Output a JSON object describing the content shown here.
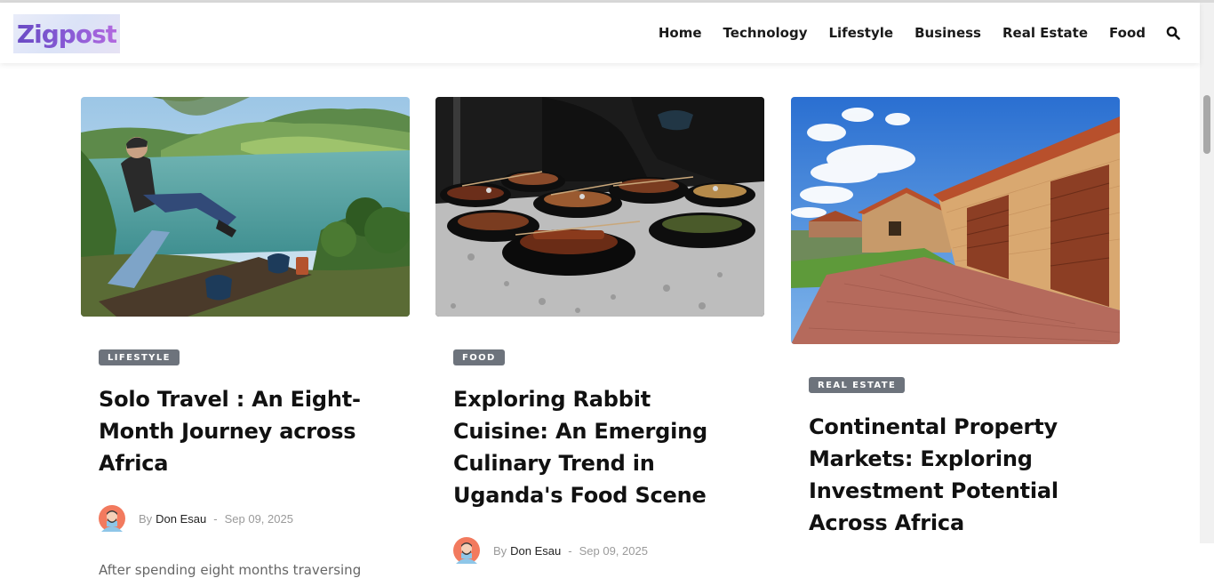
{
  "header": {
    "logo_text": "Zigpost",
    "nav": [
      "Home",
      "Technology",
      "Lifestyle",
      "Business",
      "Real Estate",
      "Food"
    ],
    "search_icon": "search-icon"
  },
  "articles": [
    {
      "category": "LIFESTYLE",
      "title": "Solo Travel : An Eight-Month Journey across Africa",
      "by": "By",
      "author": "Don Esau",
      "separator": "-",
      "date": "Sep 09, 2025",
      "excerpt": "After spending eight months traversing"
    },
    {
      "category": "FOOD",
      "title": "Exploring Rabbit Cuisine: An Emerging Culinary Trend in Uganda's Food Scene",
      "by": "By",
      "author": "Don Esau",
      "separator": "-",
      "date": "Sep 09, 2025"
    },
    {
      "category": "REAL ESTATE",
      "title": "Continental Property Markets: Exploring Investment Potential Across Africa"
    }
  ],
  "colors": {
    "badge": "#6d737c",
    "title": "#111111",
    "meta": "#9a9a9a",
    "logo_gradient": [
      "#6a4bc4",
      "#b36adf"
    ]
  }
}
